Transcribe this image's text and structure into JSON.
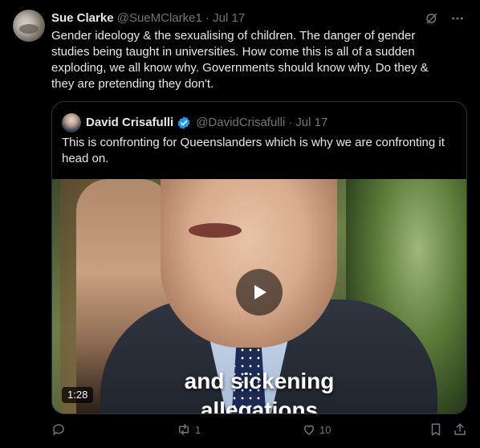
{
  "tweet": {
    "author_name": "Sue Clarke",
    "author_handle": "@SueMClarke1",
    "separator": "·",
    "date": "Jul 17",
    "text": "Gender ideology & the sexualising of children.  The danger of gender studies being taught in universities.  How come this is all of a sudden exploding, we all know why.  Governments should know why. Do they & they are pretending they don't."
  },
  "quote": {
    "author_name": "David Crisafulli",
    "author_handle": "@DavidCrisafulli",
    "separator": "·",
    "date": "Jul 17",
    "text": "This is confronting for Queenslanders which is why we are confronting it head on.",
    "video": {
      "caption_line1": "and sickening",
      "caption_line2": "allegations",
      "duration": "1:28"
    }
  },
  "actions": {
    "reply_count": "",
    "retweet_count": "1",
    "like_count": "10"
  },
  "icons": {
    "top": [
      "grok-icon",
      "more-icon"
    ],
    "actions": [
      "reply-icon",
      "retweet-icon",
      "like-icon",
      "bookmark-icon",
      "share-icon"
    ]
  },
  "colors": {
    "background": "#000000",
    "text": "#e7e9ea",
    "muted": "#71767b",
    "verified": "#1d9bf0",
    "border": "#2f3336"
  }
}
